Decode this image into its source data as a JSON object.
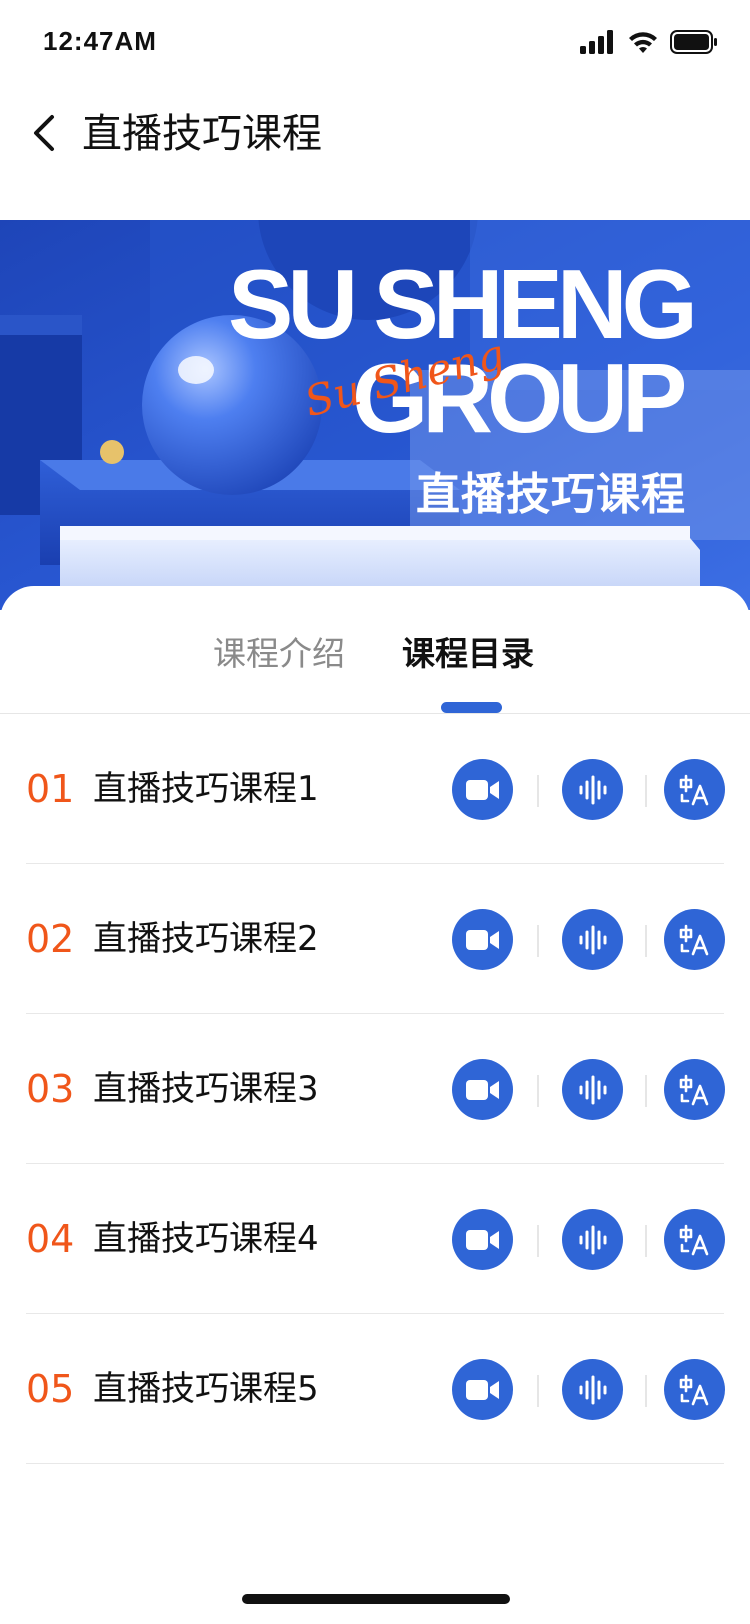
{
  "status_bar": {
    "time": "12:47AM"
  },
  "nav": {
    "title": "直播技巧课程"
  },
  "banner": {
    "line1": "SU SHENG",
    "script": "Su Sheng",
    "line2": "GROUP",
    "subtitle": "直播技巧课程"
  },
  "tabs": [
    {
      "label": "课程介绍",
      "active": false
    },
    {
      "label": "课程目录",
      "active": true
    }
  ],
  "lessons": [
    {
      "num": "01",
      "title": "直播技巧课程1"
    },
    {
      "num": "02",
      "title": "直播技巧课程2"
    },
    {
      "num": "03",
      "title": "直播技巧课程3"
    },
    {
      "num": "04",
      "title": "直播技巧课程4"
    },
    {
      "num": "05",
      "title": "直播技巧课程5"
    }
  ],
  "icons": [
    "back-arrow-icon",
    "signal-icon",
    "wifi-icon",
    "battery-icon",
    "video-icon",
    "audio-wave-icon",
    "text-translate-icon"
  ],
  "colors": {
    "accent": "#2f65d6",
    "number": "#f0561a",
    "banner": "#1f4fc8"
  }
}
